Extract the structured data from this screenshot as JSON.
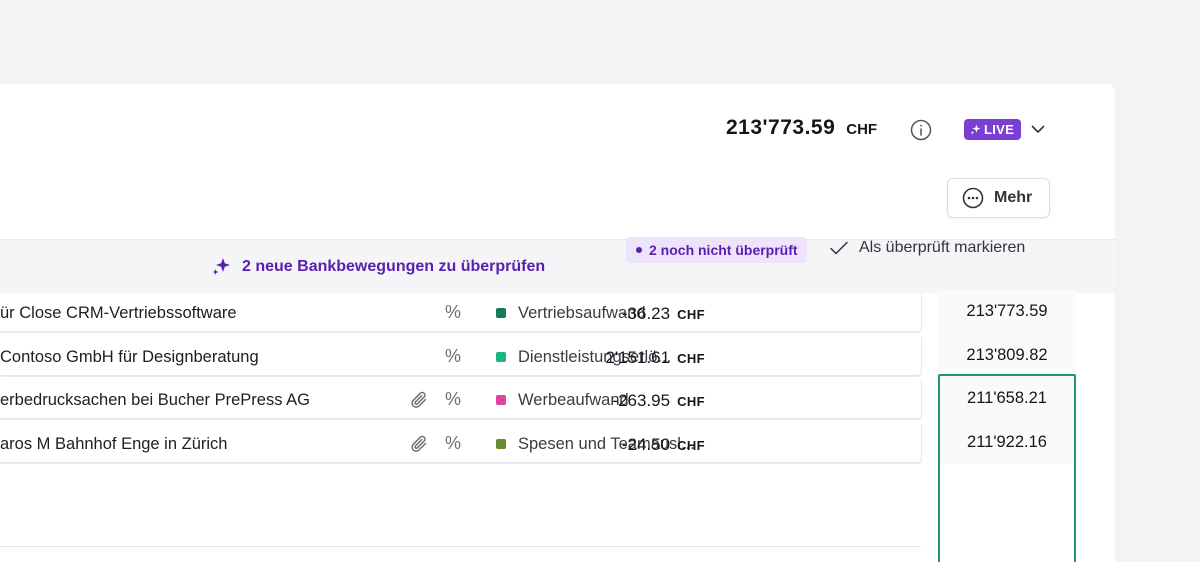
{
  "header": {
    "balance_amount": "213'773.59",
    "balance_currency": "CHF",
    "live_label": "LIVE",
    "more_label": "Mehr"
  },
  "review_banner": {
    "label": "2 neue Bankbewegungen zu überprüfen"
  },
  "filters": {
    "unreviewed_label": "2 noch nicht überprüft",
    "mark_reviewed_label": "Als überprüft markieren"
  },
  "transactions": [
    {
      "description": "ür Close CRM-Vertriebssoftware",
      "has_attachment": false,
      "percent_icon": "%",
      "category": "Vertriebsaufwand",
      "category_color": "#157a5c",
      "amount": "-36.23",
      "currency": "CHF",
      "saldo": "213'773.59"
    },
    {
      "description": "Contoso GmbH für Designberatung",
      "has_attachment": false,
      "percent_icon": "%",
      "category": "Dienstleistungserlö...",
      "category_color": "#1db584",
      "amount": "2'151.61",
      "currency": "CHF",
      "saldo": "213'809.82"
    },
    {
      "description": "erbedrucksachen bei Bucher PrePress AG",
      "has_attachment": true,
      "percent_icon": "%",
      "category": "Werbeaufwand",
      "category_color": "#e0449a",
      "amount": "-263.95",
      "currency": "CHF",
      "saldo": "211'658.21"
    },
    {
      "description": "aros M Bahnhof Enge in Zürich",
      "has_attachment": true,
      "percent_icon": "%",
      "category": "Spesen und Teamausl...",
      "category_color": "#6b8c2e",
      "amount": "-24.50",
      "currency": "CHF",
      "saldo": "211'922.16"
    }
  ],
  "colors": {
    "accent_purple": "#5b1fb0",
    "live_badge": "#7c3fd6",
    "saldo_highlight": "#23936c"
  }
}
